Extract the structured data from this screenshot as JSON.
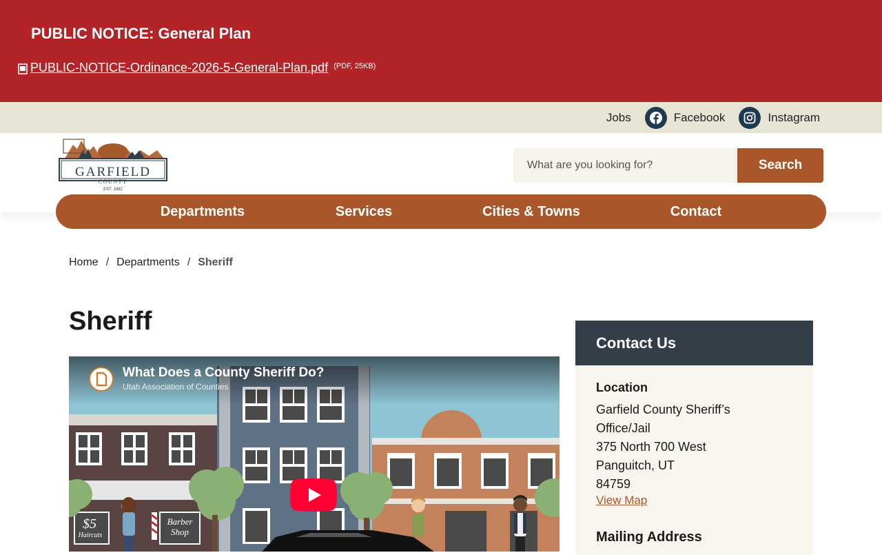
{
  "alert": {
    "title": "PUBLIC NOTICE: General Plan",
    "file_link": "PUBLIC-NOTICE-Ordinance-2026-5-General-Plan.pdf",
    "file_meta": "(PDF, 25KB)"
  },
  "utility": {
    "jobs": "Jobs",
    "facebook": "Facebook",
    "instagram": "Instagram"
  },
  "logo": {
    "name": "GARFIELD",
    "county": "COUNTY",
    "est": "EST. 1882"
  },
  "search": {
    "placeholder": "What are you looking for?",
    "button": "Search"
  },
  "nav": {
    "items": [
      "Departments",
      "Services",
      "Cities & Towns",
      "Contact"
    ]
  },
  "breadcrumb": {
    "home": "Home",
    "separator": "/",
    "departments": "Departments",
    "current": "Sheriff"
  },
  "page": {
    "title": "Sheriff"
  },
  "video": {
    "title": "What Does a County Sheriff Do?",
    "channel": "Utah Association of Counties",
    "sign_price": "$5",
    "sign_haircuts": "Haircuts",
    "sign_barber": "Barber",
    "sign_shop": "Shop"
  },
  "sidebar": {
    "heading": "Contact Us",
    "location_label": "Location",
    "address_lines": [
      "Garfield County Sheriff’s",
      "Office/Jail",
      "375 North 700 West",
      "Panguitch, UT",
      "84759"
    ],
    "map_link": "View Map",
    "mailing_label": "Mailing Address"
  },
  "colors": {
    "alert_red": "#b32428",
    "brand_brown": "#a9572a",
    "utility_beige": "#e8e4d4",
    "sidebar_dark": "#333e48"
  }
}
